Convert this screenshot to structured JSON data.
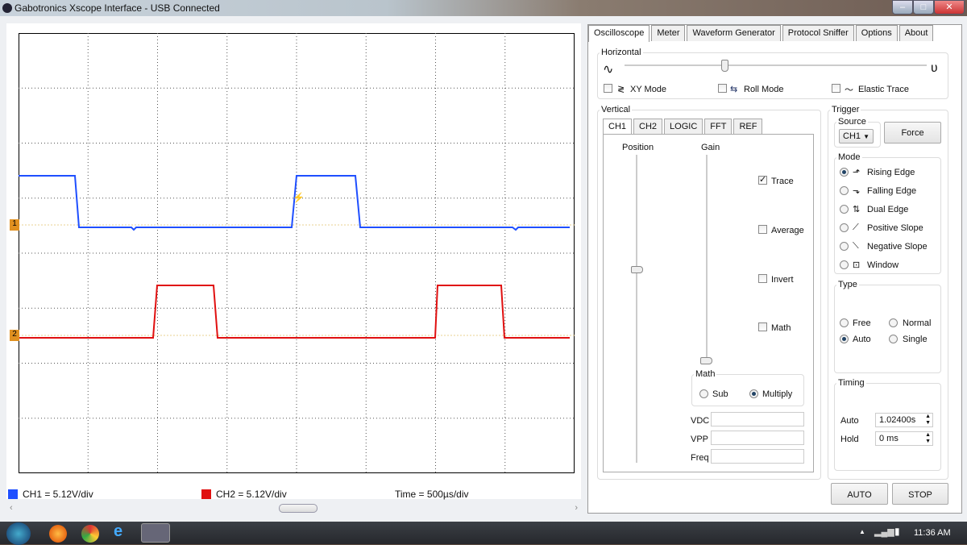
{
  "window": {
    "title": "Gabotronics Xscope Interface - USB Connected"
  },
  "tabs": [
    "Oscilloscope",
    "Meter",
    "Waveform Generator",
    "Protocol Sniffer",
    "Options",
    "About"
  ],
  "horizontal": {
    "label": "Horizontal",
    "slider_position_fraction": 0.33,
    "xy_mode": "XY Mode",
    "roll_mode": "Roll Mode",
    "elastic_trace": "Elastic Trace",
    "xy_checked": false,
    "roll_checked": false,
    "elastic_checked": false
  },
  "vertical": {
    "label": "Vertical",
    "tabs": [
      "CH1",
      "CH2",
      "LOGIC",
      "FFT",
      "REF"
    ],
    "position_label": "Position",
    "gain_label": "Gain",
    "options": [
      {
        "label": "Trace",
        "checked": true
      },
      {
        "label": "Average",
        "checked": false
      },
      {
        "label": "Invert",
        "checked": false
      },
      {
        "label": "Math",
        "checked": false
      }
    ],
    "math": {
      "label": "Math",
      "sub": "Sub",
      "multiply": "Multiply",
      "selected": "Multiply"
    },
    "vdc": "VDC",
    "vpp": "VPP",
    "freq": "Freq"
  },
  "trigger": {
    "label": "Trigger",
    "source_label": "Source",
    "source": "CH1",
    "force": "Force",
    "mode_label": "Mode",
    "modes": [
      "Rising Edge",
      "Falling Edge",
      "Dual Edge",
      "Positive Slope",
      "Negative Slope",
      "Window"
    ],
    "mode_selected": "Rising Edge",
    "type_label": "Type",
    "types": [
      "Free",
      "Normal",
      "Auto",
      "Single"
    ],
    "type_selected": "Auto",
    "timing_label": "Timing",
    "auto_label": "Auto",
    "auto_value": "1.02400s",
    "hold_label": "Hold",
    "hold_value": "0 ms"
  },
  "buttons": {
    "auto": "AUTO",
    "stop": "STOP"
  },
  "status": {
    "ch1": "CH1 = 5.12V/div",
    "ch2": "CH2 = 5.12V/div",
    "time": "Time = 500µs/div"
  },
  "markers": {
    "ch1": "1",
    "ch2": "2"
  },
  "colors": {
    "ch1": "#1f4fff",
    "ch2": "#e01010"
  },
  "taskbar": {
    "clock": "11:36 AM"
  }
}
